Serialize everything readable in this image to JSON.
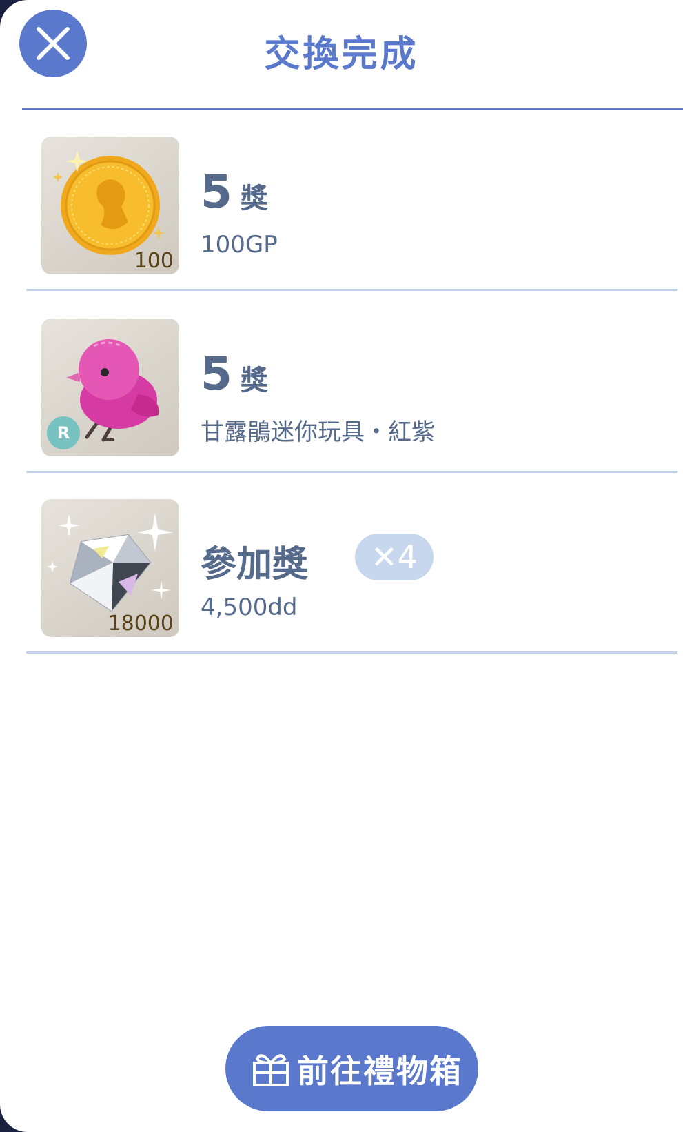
{
  "header": {
    "title": "交換完成",
    "close_icon": "close-icon"
  },
  "rewards": [
    {
      "prize_number": "5",
      "prize_unit": "獎",
      "description": "100GP",
      "thumb_icon": "gold-coin-icon",
      "thumb_count": "100"
    },
    {
      "prize_number": "5",
      "prize_unit": "獎",
      "description": "甘露鵑迷你玩具・紅紫",
      "thumb_icon": "pink-bird-toy-icon",
      "rarity": "R"
    },
    {
      "prize_label": "參加獎",
      "multiplier": "✕4",
      "description": "4,500dd",
      "thumb_icon": "diamond-icon",
      "thumb_count": "18000"
    }
  ],
  "footer": {
    "gift_button_label": "前往禮物箱",
    "gift_icon": "gift-box-icon"
  },
  "colors": {
    "accent": "#5a78cc",
    "text": "#566a8c",
    "separator": "#c3d3ec",
    "badge": "#c6d7ee",
    "rarity": "#78c3c2"
  }
}
